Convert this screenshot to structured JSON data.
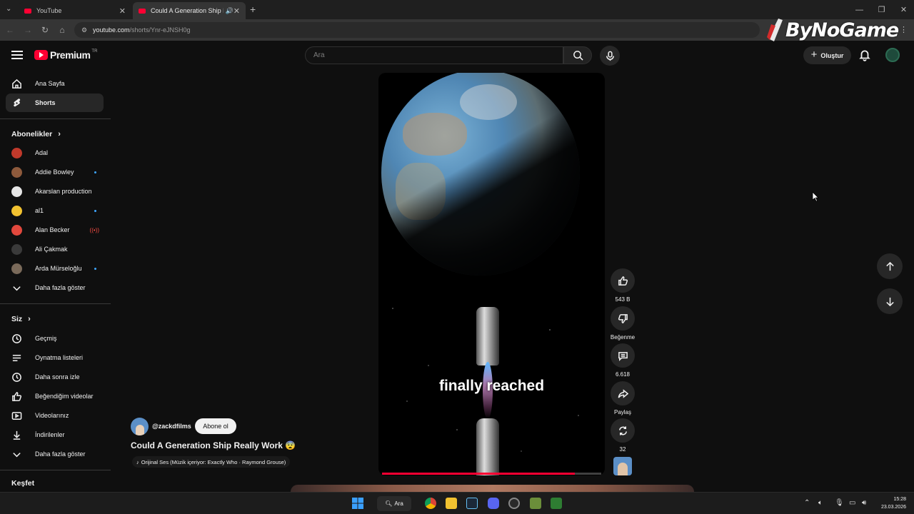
{
  "browser": {
    "tabs": [
      {
        "title": "YouTube"
      },
      {
        "title": "Could A Generation Ship Re"
      }
    ],
    "url_host": "youtube.com",
    "url_path": "/shorts/Ynr-eJNSH0g",
    "overlay_logo": "ByNoGame"
  },
  "header": {
    "logo_text": "Premium",
    "logo_country": "TR",
    "search_placeholder": "Ara",
    "create_label": "Oluştur"
  },
  "sidebar": {
    "main": [
      {
        "label": "Ana Sayfa",
        "icon": "home-icon"
      },
      {
        "label": "Shorts",
        "icon": "shorts-icon",
        "active": true
      }
    ],
    "subscriptions_title": "Abonelikler",
    "subscriptions": [
      {
        "label": "Adal",
        "color": "#c0392b",
        "dot": false
      },
      {
        "label": "Addie Bowley",
        "color": "#8e5a3c",
        "dot": true
      },
      {
        "label": "Akarslan production",
        "color": "#e6e6e6",
        "dot": false
      },
      {
        "label": "al1",
        "color": "#f2c230",
        "dot": true
      },
      {
        "label": "Alan Becker",
        "color": "#e2483d",
        "dot": false,
        "live": true
      },
      {
        "label": "Ali Çakmak",
        "color": "#3a3a3a",
        "dot": false
      },
      {
        "label": "Arda Mürseloğlu",
        "color": "#7a6a5a",
        "dot": true
      }
    ],
    "show_more_subs": "Daha fazla göster",
    "you_title": "Siz",
    "you": [
      {
        "label": "Geçmiş",
        "icon": "history-icon"
      },
      {
        "label": "Oynatma listeleri",
        "icon": "playlists-icon"
      },
      {
        "label": "Daha sonra izle",
        "icon": "watch-later-icon"
      },
      {
        "label": "Beğendiğim videolar",
        "icon": "liked-icon"
      },
      {
        "label": "Videolarınız",
        "icon": "your-videos-icon"
      },
      {
        "label": "İndirilenler",
        "icon": "download-icon"
      }
    ],
    "show_more_you": "Daha fazla göster",
    "explore_title": "Keşfet"
  },
  "video": {
    "caption": "finally reached",
    "progress": 0.88,
    "channel_handle": "@zackdfilms",
    "subscribe_label": "Abone ol",
    "title": "Could A Generation Ship Really Work 😨",
    "audio": "Orijinal Ses (Müzik içeriyor: Exactly Who · Raymond Grouse)"
  },
  "actions": {
    "likes": "543 B",
    "dislike_label": "Beğenme",
    "comments": "6.618",
    "share_label": "Paylaş",
    "remix_count": "32"
  },
  "taskbar": {
    "search_label": "Ara",
    "time": "15:28",
    "date": "23.03.2026"
  },
  "colors": {
    "accent": "#ff0033",
    "background": "#0f0f0f",
    "surface": "#272727"
  }
}
